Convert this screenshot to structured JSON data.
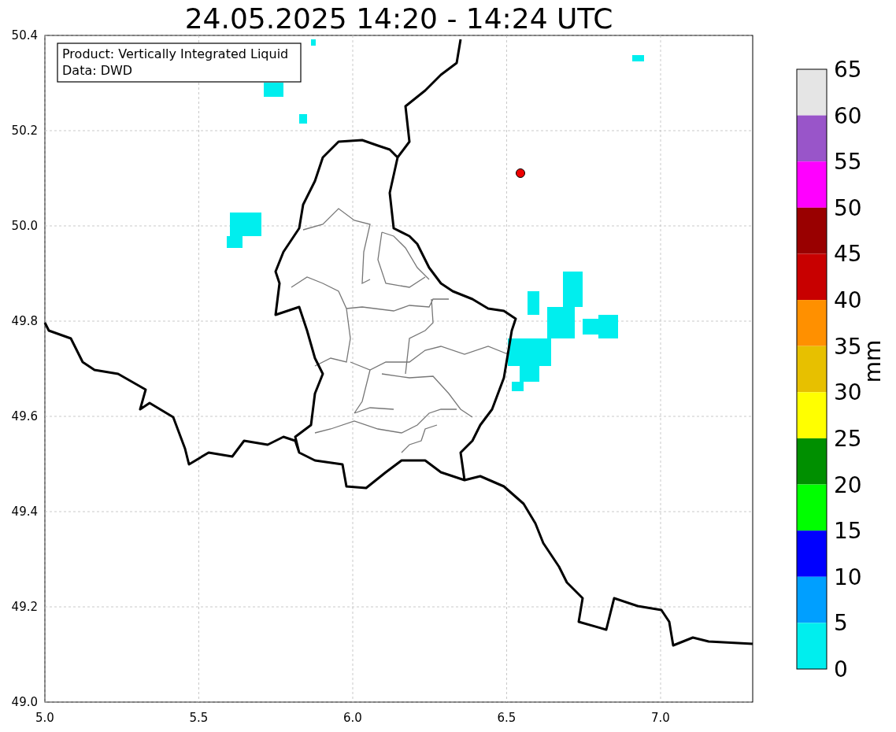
{
  "figure": {
    "title": "24.05.2025 14:20 - 14:24 UTC"
  },
  "legend": {
    "lines": [
      "Product: Vertically Integrated Liquid",
      "Data: DWD"
    ]
  },
  "map": {
    "x_ticks": [
      "5.0",
      "5.5",
      "6.0",
      "6.5",
      "7.0"
    ],
    "y_ticks": [
      "50.4",
      "50.2",
      "50.0",
      "49.8",
      "49.6",
      "49.4",
      "49.2",
      "49.0"
    ]
  },
  "colorbar": {
    "label": "mm",
    "ticks": [
      "65",
      "60",
      "55",
      "50",
      "45",
      "40",
      "35",
      "30",
      "25",
      "20",
      "15",
      "10",
      "5",
      "0"
    ],
    "bins": [
      {
        "color": "#e5e5e5"
      },
      {
        "color": "#9955c9"
      },
      {
        "color": "#ff00ff"
      },
      {
        "color": "#990000"
      },
      {
        "color": "#c80000"
      },
      {
        "color": "#ff9000"
      },
      {
        "color": "#e7c000"
      },
      {
        "color": "#ffff00"
      },
      {
        "color": "#008f00"
      },
      {
        "color": "#00ff00"
      },
      {
        "color": "#0000ff"
      },
      {
        "color": "#009fff"
      },
      {
        "color": "#00eeee"
      }
    ]
  }
}
